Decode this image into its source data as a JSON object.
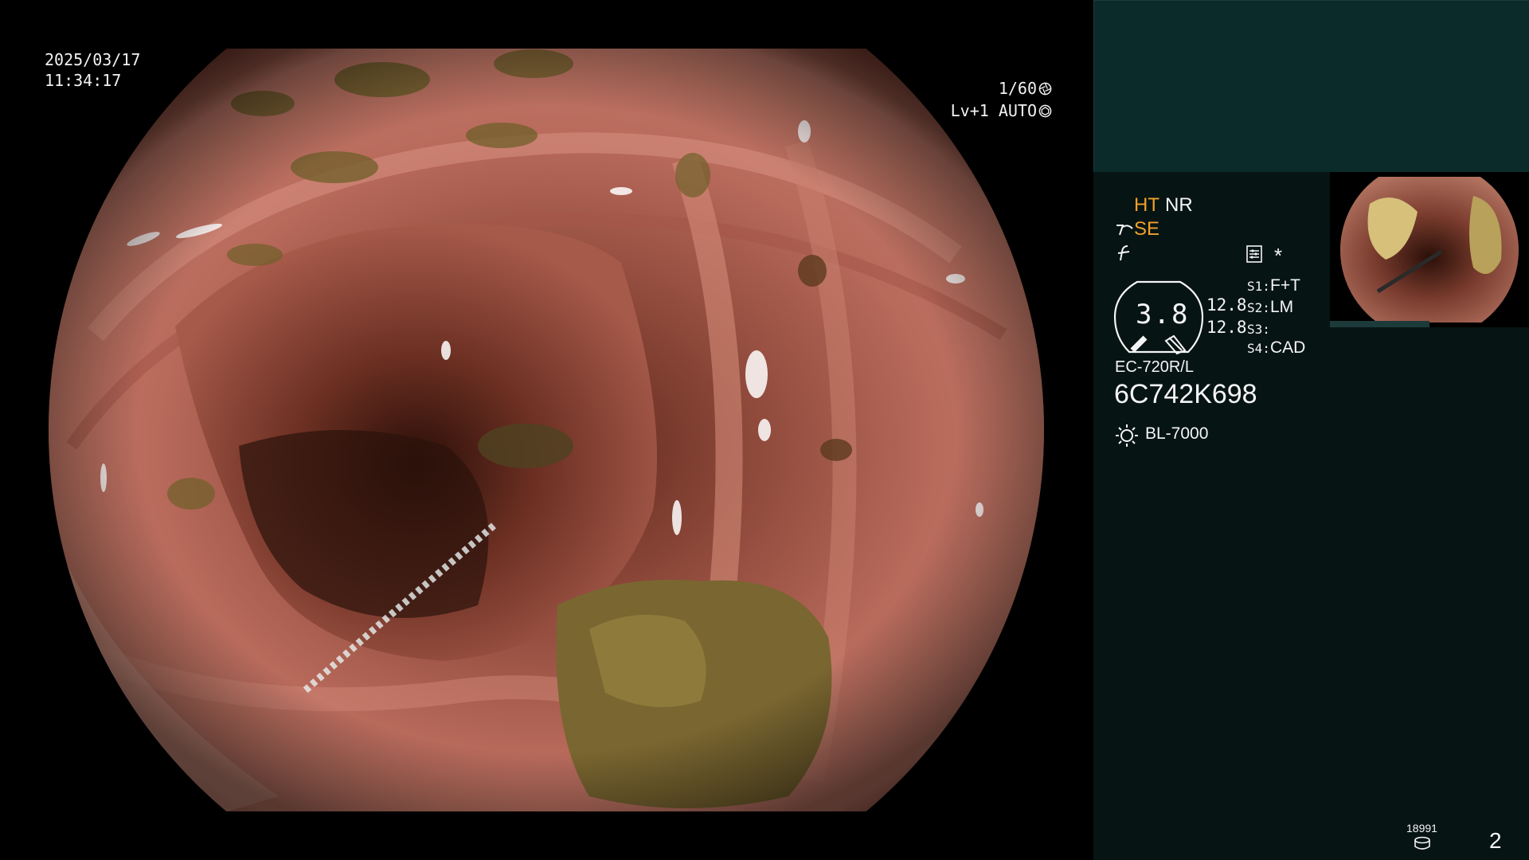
{
  "osd": {
    "date": "2025/03/17",
    "time": "11:34:17",
    "shutter": "1/60",
    "shutter_icon": "aperture-icon",
    "level": "Lv+1 AUTO",
    "auto_icon": "iris-icon"
  },
  "panel": {
    "mode_ht": "HT",
    "mode_nr": "NR",
    "mode_se": "SE",
    "enhance_icon": "structure-enhance-icon",
    "color_icon": "color-mode-icon",
    "settings_icon": "settings-list-icon",
    "asterisk": "*",
    "zoom_value": "3.8",
    "zoom_a": "12.8",
    "zoom_b": "12.8",
    "s1_key": "S1:",
    "s1_val": "F+T",
    "s2_key": "S2:",
    "s2_val": "LM",
    "s3_key": "S3:",
    "s3_val": "",
    "s4_key": "S4:",
    "s4_val": "CAD",
    "scope_model": "EC-720R/L",
    "serial": "6C742K698",
    "light_source": "BL-7000",
    "light_icon": "light-source-icon",
    "storage_count": "18991",
    "storage_icon": "storage-disk-icon",
    "page_number": "2"
  },
  "colors": {
    "accent_orange": "#f0a12a",
    "panel_top": "#0b2a2a",
    "panel_bottom": "#071414",
    "mucosa": "#b8675a",
    "stool": "#7a6630"
  }
}
